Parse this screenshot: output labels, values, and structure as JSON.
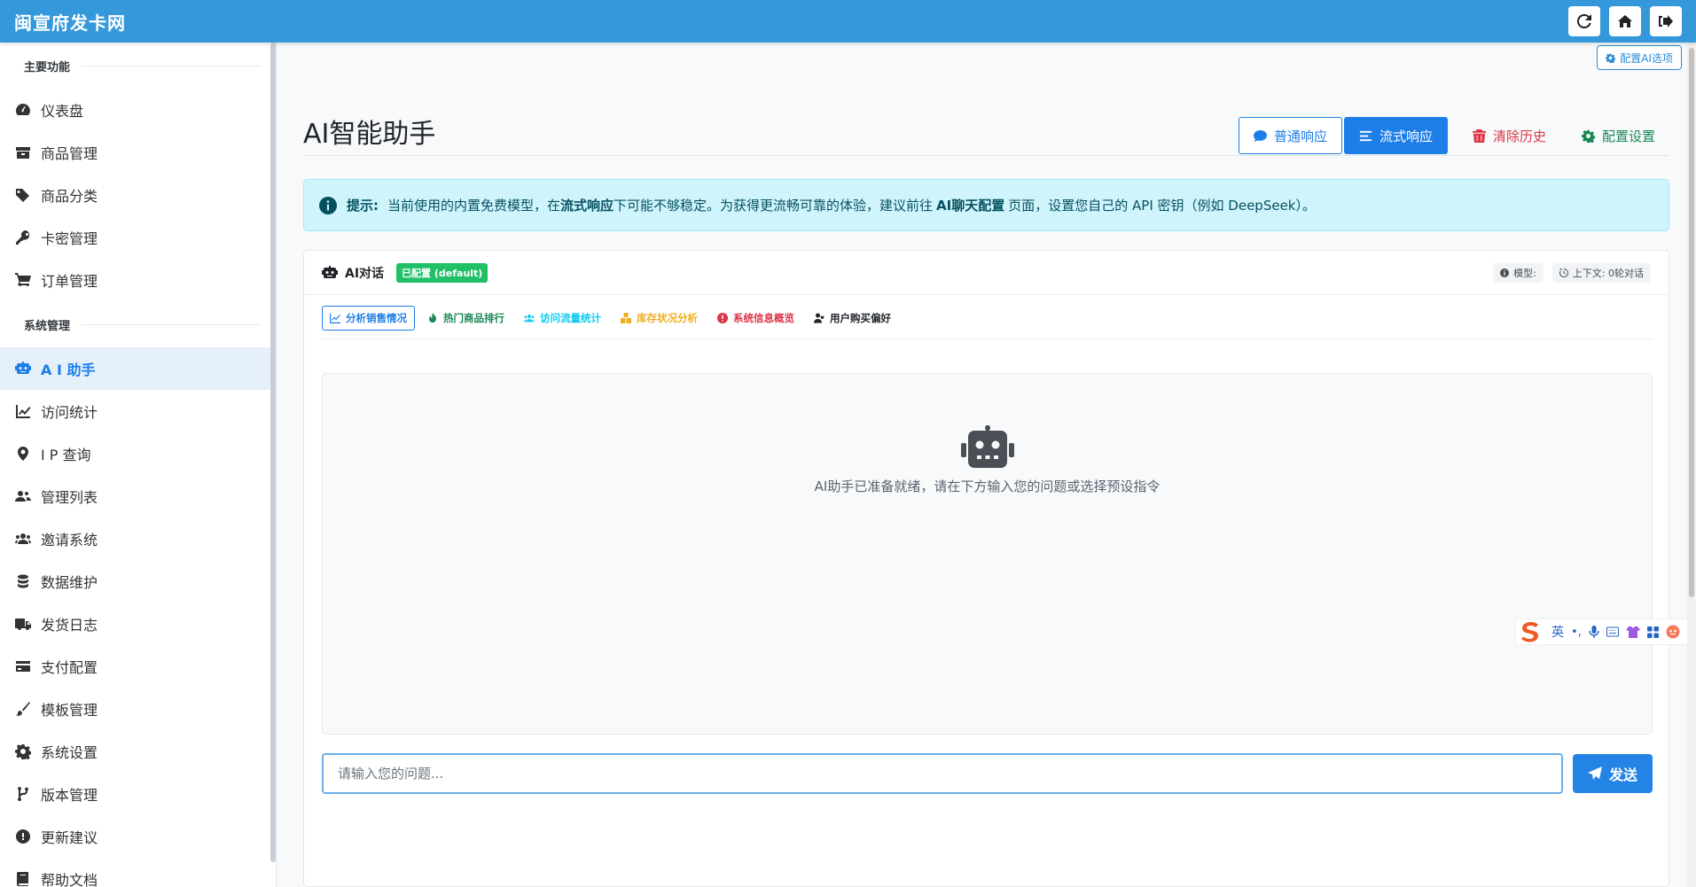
{
  "topbar": {
    "brand": "闽宣府发卡网"
  },
  "sidebar": {
    "section_main": "主要功能",
    "section_system": "系统管理",
    "main_items": [
      {
        "label": "仪表盘",
        "icon": "dashboard-icon"
      },
      {
        "label": "商品管理",
        "icon": "box-icon"
      },
      {
        "label": "商品分类",
        "icon": "tags-icon"
      },
      {
        "label": "卡密管理",
        "icon": "key-icon"
      },
      {
        "label": "订单管理",
        "icon": "cart-icon"
      }
    ],
    "system_items": [
      {
        "label": "A I 助手",
        "icon": "robot-icon",
        "active": true
      },
      {
        "label": "访问统计",
        "icon": "chart-line-icon"
      },
      {
        "label": "I P 查询",
        "icon": "map-pin-icon"
      },
      {
        "label": "管理列表",
        "icon": "users-cog-icon"
      },
      {
        "label": "邀请系统",
        "icon": "users-icon"
      },
      {
        "label": "数据维护",
        "icon": "database-icon"
      },
      {
        "label": "发货日志",
        "icon": "truck-icon"
      },
      {
        "label": "支付配置",
        "icon": "credit-card-icon"
      },
      {
        "label": "模板管理",
        "icon": "paint-brush-icon"
      },
      {
        "label": "系统设置",
        "icon": "gear-icon"
      },
      {
        "label": "版本管理",
        "icon": "code-branch-icon"
      },
      {
        "label": "更新建议",
        "icon": "exclamation-circle-icon"
      },
      {
        "label": "帮助文档",
        "icon": "book-icon"
      }
    ]
  },
  "main": {
    "config_ai_label": "配置AI选项",
    "title": "AI智能助手",
    "actions": {
      "normal": "普通响应",
      "stream": "流式响应",
      "clear": "清除历史",
      "settings": "配置设置"
    },
    "alert": {
      "prefix": "提示:",
      "text1": "当前使用的内置免费模型，在",
      "bold1": "流式响应",
      "text2": "下可能不够稳定。为获得更流畅可靠的体验，建议前往",
      "bold2": "AI聊天配置",
      "text3": "页面，设置您自己的 API 密钥（例如 DeepSeek）。"
    },
    "chat": {
      "title": "AI对话",
      "status_badge": "已配置 (default)",
      "model_label": "模型:",
      "context_label": "上下文: 0轮对话",
      "presets": [
        {
          "label": "分析销售情况",
          "color": "#1e7ee8",
          "icon": "chart-icon"
        },
        {
          "label": "热门商品排行",
          "color": "#198754",
          "icon": "fire-icon"
        },
        {
          "label": "访问流量统计",
          "color": "#0dcaf0",
          "icon": "users-icon"
        },
        {
          "label": "库存状况分析",
          "color": "#f0ad1e",
          "icon": "boxes-icon"
        },
        {
          "label": "系统信息概览",
          "color": "#dc3545",
          "icon": "exclamation-icon"
        },
        {
          "label": "用户购买偏好",
          "color": "#212529",
          "icon": "user-heart-icon"
        }
      ],
      "empty_message": "AI助手已准备就绪，请在下方输入您的问题或选择预设指令",
      "input_placeholder": "请输入您的问题...",
      "send_label": "发送"
    }
  },
  "ime": {
    "lang": "英",
    "punct": "•,",
    "extra": ""
  }
}
